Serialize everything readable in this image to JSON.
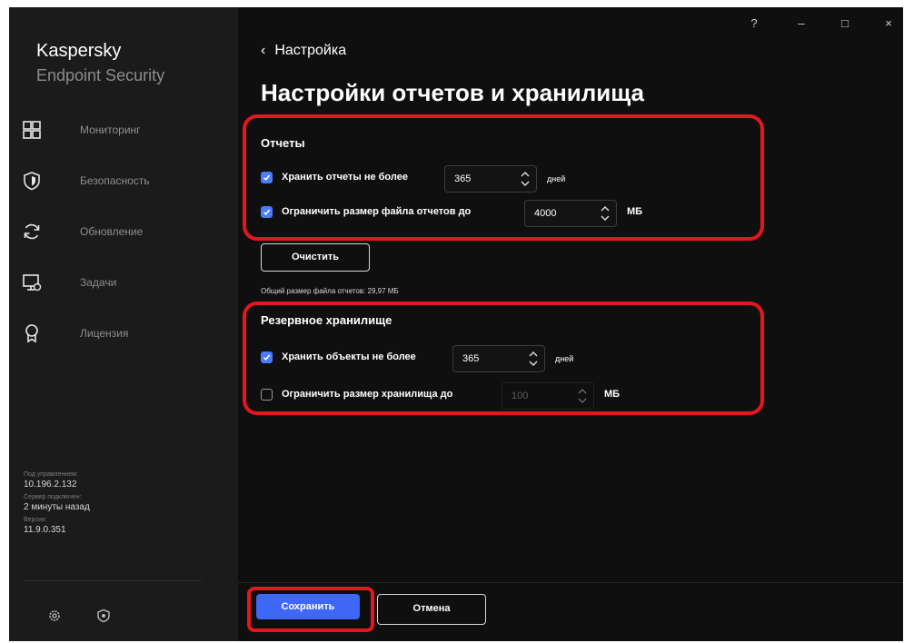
{
  "app": {
    "name": "Kaspersky",
    "subtitle": "Endpoint Security"
  },
  "titlebar": {
    "help": "?",
    "minimize": "–",
    "maximize": "□",
    "close": "×"
  },
  "sidebar": {
    "items": [
      {
        "label": "Мониторинг",
        "icon": "monitoring-icon"
      },
      {
        "label": "Безопасность",
        "icon": "shield-icon"
      },
      {
        "label": "Обновление",
        "icon": "update-icon"
      },
      {
        "label": "Задачи",
        "icon": "tasks-icon"
      },
      {
        "label": "Лицензия",
        "icon": "license-icon"
      }
    ],
    "info": {
      "managed_label": "Под управлением:",
      "managed_value": "10.196.2.132",
      "server_label": "Сервер подключен:",
      "server_value": "2 минуты назад",
      "version_label": "Версия:",
      "version_value": "11.9.0.351"
    },
    "bottom_icons": [
      "settings-icon",
      "support-icon"
    ]
  },
  "header": {
    "back_label": "Настройка",
    "title": "Настройки отчетов и хранилища"
  },
  "reports": {
    "title": "Отчеты",
    "keep": {
      "checked": true,
      "label": "Хранить отчеты не более",
      "value": "365",
      "unit": "дней"
    },
    "limit": {
      "checked": true,
      "label": "Ограничить размер файла отчетов до",
      "value": "4000",
      "unit": "МБ"
    },
    "clear_button": "Очистить",
    "total_size": "Общий размер файла отчетов: 29,97 МБ"
  },
  "backup": {
    "title": "Резервное хранилище",
    "keep": {
      "checked": true,
      "label": "Хранить объекты не более",
      "value": "365",
      "unit": "дней"
    },
    "limit": {
      "checked": false,
      "label": "Ограничить размер хранилища до",
      "value": "100",
      "unit": "МБ"
    }
  },
  "footer": {
    "save": "Сохранить",
    "cancel": "Отмена"
  },
  "colors": {
    "accent": "#3e67f6",
    "highlight": "#e4161f",
    "background": "#0f0f0f",
    "sidebar": "#1b1b1b"
  }
}
